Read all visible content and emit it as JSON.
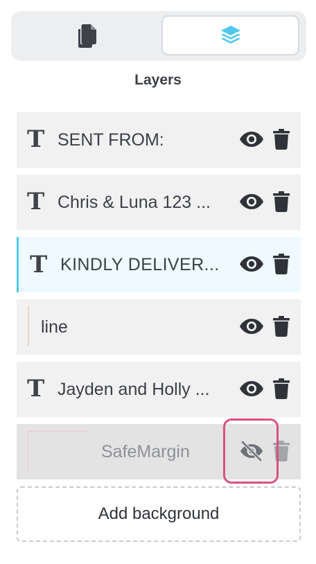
{
  "tabs": {
    "pages_icon": "copy-pages-icon",
    "layers_icon": "layers-stack-icon",
    "active": "layers"
  },
  "section_title": "Layers",
  "layers": [
    {
      "type": "text",
      "name": "SENT FROM:",
      "visible": true,
      "selected": false
    },
    {
      "type": "text",
      "name": "Chris & Luna 123 ...",
      "visible": true,
      "selected": false
    },
    {
      "type": "text",
      "name": "KINDLY DELIVER...",
      "visible": true,
      "selected": true
    },
    {
      "type": "line",
      "name": "line",
      "visible": true,
      "selected": false
    },
    {
      "type": "text",
      "name": "Jayden and Holly ...",
      "visible": true,
      "selected": false
    },
    {
      "type": "shape",
      "name": "SafeMargin",
      "visible": false,
      "selected": false
    }
  ],
  "add_background_label": "Add background",
  "colors": {
    "accent": "#4fc9ec",
    "highlight": "#d9507f",
    "row_bg": "#f1f1f2",
    "selected_bg": "#eefaff"
  }
}
